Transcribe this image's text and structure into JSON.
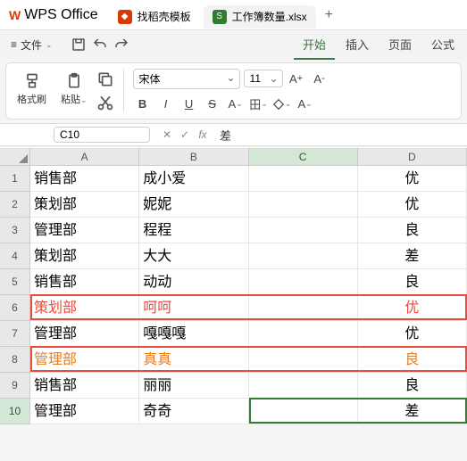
{
  "app_name": "WPS Office",
  "tabs": [
    {
      "icon_bg": "#d83b01",
      "icon_text": "",
      "label": "找稻壳模板"
    },
    {
      "icon_bg": "#2e7d32",
      "icon_text": "S",
      "label": "工作簿数量.xlsx"
    }
  ],
  "menu": {
    "file": "文件",
    "tabs": [
      "开始",
      "插入",
      "页面",
      "公式"
    ],
    "active_tab": "开始"
  },
  "ribbon": {
    "format_painter": "格式刷",
    "paste": "粘贴",
    "font_name": "宋体",
    "font_size": "11",
    "bold": "B",
    "italic": "I",
    "underline": "U",
    "strike": "S"
  },
  "name_box": "C10",
  "formula": "差",
  "columns": [
    "A",
    "B",
    "C",
    "D"
  ],
  "rows": [
    {
      "n": 1,
      "a": "销售部",
      "b": "成小爱",
      "d": "优"
    },
    {
      "n": 2,
      "a": "策划部",
      "b": "妮妮",
      "d": "优"
    },
    {
      "n": 3,
      "a": "管理部",
      "b": "程程",
      "d": "良"
    },
    {
      "n": 4,
      "a": "策划部",
      "b": "大大",
      "d": "差"
    },
    {
      "n": 5,
      "a": "销售部",
      "b": "动动",
      "d": "良"
    },
    {
      "n": 6,
      "a": "策划部",
      "b": "呵呵",
      "d": "优",
      "style": "red"
    },
    {
      "n": 7,
      "a": "管理部",
      "b": "嘎嘎嘎",
      "d": "优"
    },
    {
      "n": 8,
      "a": "管理部",
      "b": "真真",
      "d": "良",
      "style": "orange"
    },
    {
      "n": 9,
      "a": "销售部",
      "b": "丽丽",
      "d": "良"
    },
    {
      "n": 10,
      "a": "管理部",
      "b": "奇奇",
      "d": "差"
    }
  ]
}
